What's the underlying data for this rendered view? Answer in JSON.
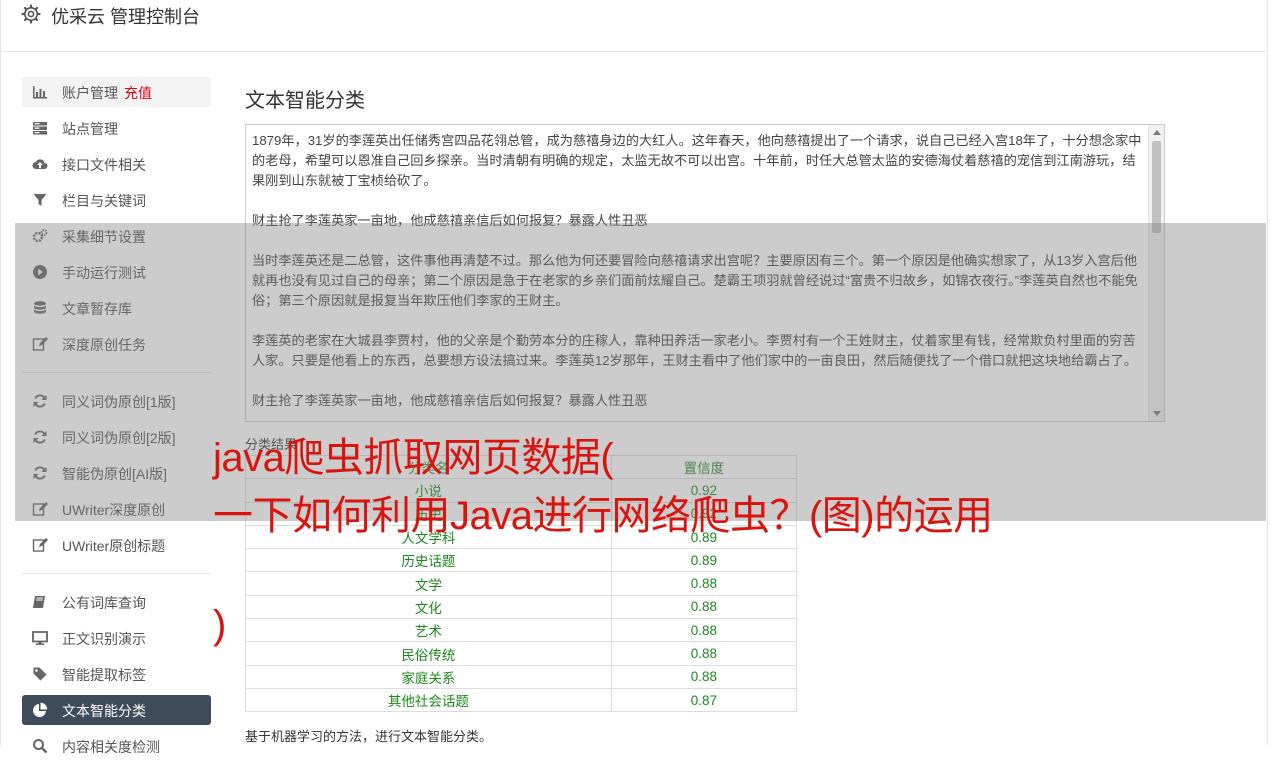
{
  "app": {
    "title": "优采云 管理控制台"
  },
  "sidebar": {
    "items": [
      {
        "label": "账户管理",
        "badge": "充值",
        "icon": "bar-chart-icon"
      },
      {
        "label": "站点管理",
        "icon": "server-icon"
      },
      {
        "label": "接口文件相关",
        "icon": "cloud-upload-icon"
      },
      {
        "label": "栏目与关键词",
        "icon": "filter-icon"
      },
      {
        "label": "采集细节设置",
        "icon": "gears-icon"
      },
      {
        "label": "手动运行测试",
        "icon": "play-circle-icon"
      },
      {
        "label": "文章暂存库",
        "icon": "database-icon"
      },
      {
        "label": "深度原创任务",
        "icon": "edit-icon"
      },
      {
        "label": "同义词伪原创[1版]",
        "icon": "refresh-icon"
      },
      {
        "label": "同义词伪原创[2版]",
        "icon": "refresh-icon"
      },
      {
        "label": "智能伪原创[AI版]",
        "icon": "refresh-icon"
      },
      {
        "label": "UWriter深度原创",
        "icon": "edit-icon"
      },
      {
        "label": "UWriter原创标题",
        "icon": "edit-icon"
      },
      {
        "label": "公有词库查询",
        "icon": "book-icon"
      },
      {
        "label": "正文识别演示",
        "icon": "desktop-icon"
      },
      {
        "label": "智能提取标签",
        "icon": "tag-icon"
      },
      {
        "label": "文本智能分类",
        "icon": "pie-chart-icon"
      },
      {
        "label": "内容相关度检测",
        "icon": "search-icon"
      }
    ]
  },
  "main": {
    "title": "文本智能分类",
    "paragraphs": [
      "1879年，31岁的李莲英出任储秀宫四品花翎总管，成为慈禧身边的大红人。这年春天，他向慈禧提出了一个请求，说自己已经入宫18年了，十分想念家中的老母，希望可以恩准自己回乡探亲。当时清朝有明确的规定，太监无故不可以出宫。十年前，时任大总管太监的安德海仗着慈禧的宠信到江南游玩，结果刚到山东就被丁宝桢给砍了。",
      "财主抢了李莲英家一亩地，他成慈禧亲信后如何报复？暴露人性丑恶",
      "当时李莲英还是二总管，这件事他再清楚不过。那么他为何还要冒险向慈禧请求出宫呢？主要原因有三个。第一个原因是他确实想家了，从13岁入宫后他就再也没有见过自己的母亲；第二个原因是急于在老家的乡亲们面前炫耀自己。楚霸王项羽就曾经说过“富贵不归故乡，如锦衣夜行。”李莲英自然也不能免俗；第三个原因就是报复当年欺压他们李家的王财主。",
      "李莲英的老家在大城县李贾村，他的父亲是个勤劳本分的庄稼人，靠种田养活一家老小。李贾村有一个王姓财主，仗着家里有钱，经常欺负村里面的穷苦人家。只要是他看上的东西，总要想方设法搞过来。李莲英12岁那年，王财主看中了他们家中的一亩良田，然后随便找了一个借口就把这块地给霸占了。",
      "财主抢了李莲英家一亩地，他成慈禧亲信后如何报复？暴露人性丑恶"
    ],
    "result_label": "分类结果",
    "table": {
      "headers": [
        "分类名",
        "置信度"
      ],
      "rows": [
        [
          "小说",
          "0.92"
        ],
        [
          "历史",
          "0.92"
        ],
        [
          "人文学科",
          "0.89"
        ],
        [
          "历史话题",
          "0.89"
        ],
        [
          "文学",
          "0.88"
        ],
        [
          "文化",
          "0.88"
        ],
        [
          "艺术",
          "0.88"
        ],
        [
          "民俗传统",
          "0.88"
        ],
        [
          "家庭关系",
          "0.88"
        ],
        [
          "其他社会话题",
          "0.87"
        ]
      ]
    },
    "footer_note": "基于机器学习的方法，进行文本智能分类。"
  },
  "overlay": {
    "line1": "java爬虫抓取网页数据(",
    "line2": "一下如何利用Java进行网络爬虫？(图)的运用",
    "line3": ")"
  }
}
